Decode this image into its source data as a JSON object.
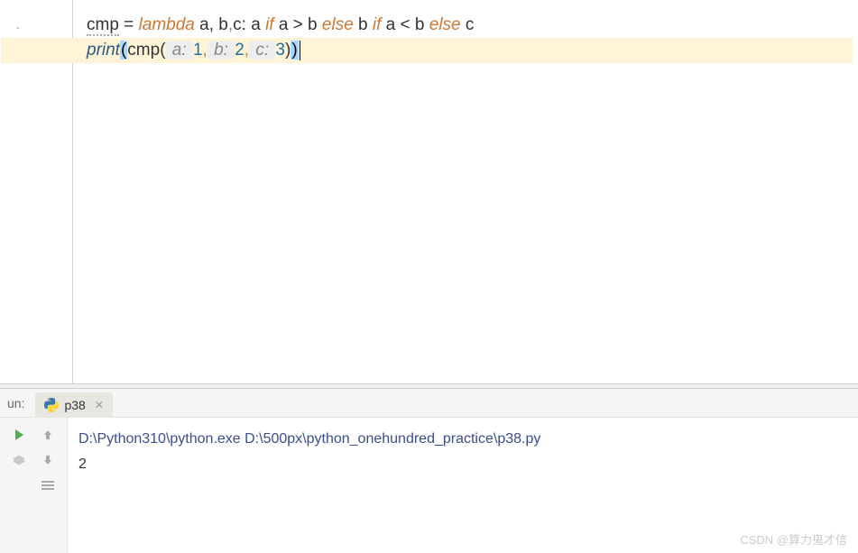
{
  "editor": {
    "gutter": [
      ".",
      "."
    ],
    "line1": {
      "var": "cmp",
      "eq": " = ",
      "lambda": "lambda",
      "params": " a, b",
      "params2": "c: a ",
      "if1": "if",
      "cond1": " a > b ",
      "else1": "else",
      "mid": " b ",
      "if2": "if",
      "cond2": " a < b ",
      "else2": "else",
      "tail": " c"
    },
    "line2": {
      "print": "print",
      "open": "(",
      "fn": "cmp",
      "hint_a": " a: ",
      "val1": "1",
      "hint_b": " b: ",
      "val2": "2",
      "hint_c": " c: ",
      "val3": "3",
      "close": ")"
    }
  },
  "panel": {
    "label": "un:",
    "tab_name": "p38",
    "cmd": "D:\\Python310\\python.exe D:\\500px\\python_onehundred_practice\\p38.py",
    "output": "2"
  },
  "watermark": "CSDN @算力鬼才信"
}
